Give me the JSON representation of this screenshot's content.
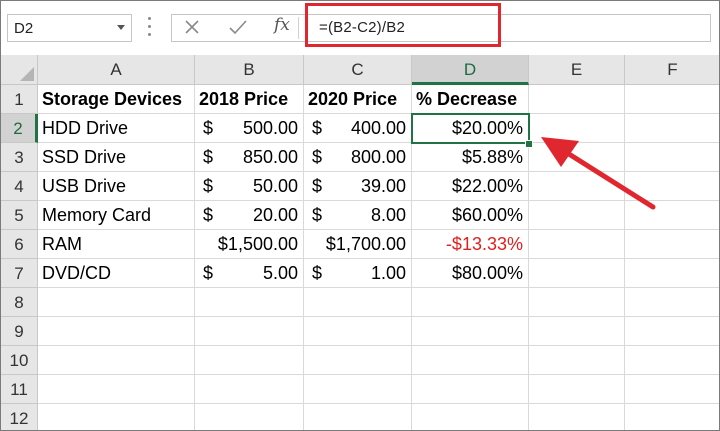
{
  "formula_bar": {
    "name_box": "D2",
    "cancel_icon": "close-icon",
    "enter_icon": "check-icon",
    "function_label": "fx",
    "formula": "=(B2-C2)/B2"
  },
  "columns": [
    "A",
    "B",
    "C",
    "D",
    "E",
    "F"
  ],
  "rows": [
    "1",
    "2",
    "3",
    "4",
    "5",
    "6",
    "7",
    "8",
    "9",
    "10",
    "11",
    "12"
  ],
  "headers": {
    "a": "Storage Devices",
    "b": "2018 Price",
    "c": "2020 Price",
    "d": "% Decrease"
  },
  "data_rows": [
    {
      "device": "HDD Drive",
      "p2018_cur": "$",
      "p2018": "500.00",
      "p2020_cur": "$",
      "p2020": "400.00",
      "decrease": "$20.00%"
    },
    {
      "device": "SSD Drive",
      "p2018_cur": "$",
      "p2018": "850.00",
      "p2020_cur": "$",
      "p2020": "800.00",
      "decrease": "$5.88%"
    },
    {
      "device": "USB Drive",
      "p2018_cur": "$",
      "p2018": "50.00",
      "p2020_cur": "$",
      "p2020": "39.00",
      "decrease": "$22.00%"
    },
    {
      "device": "Memory Card",
      "p2018_cur": "$",
      "p2018": "20.00",
      "p2020_cur": "$",
      "p2020": "8.00",
      "decrease": "$60.00%"
    },
    {
      "device": "RAM",
      "p2018_cur": "",
      "p2018": "$1,500.00",
      "p2020_cur": "",
      "p2020": "$1,700.00",
      "decrease": "-$13.33%"
    },
    {
      "device": "DVD/CD",
      "p2018_cur": "$",
      "p2018": "5.00",
      "p2020_cur": "$",
      "p2020": "1.00",
      "decrease": "$80.00%"
    }
  ],
  "colors": {
    "highlight": "#e0262e",
    "selection": "#217346",
    "negative": "#e02020"
  }
}
